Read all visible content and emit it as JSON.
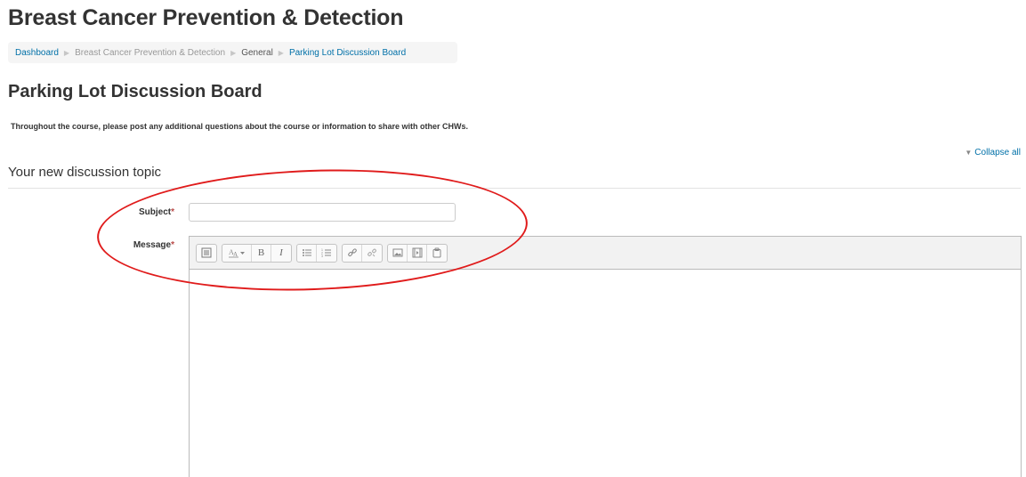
{
  "course": {
    "title": "Breast Cancer Prevention & Detection"
  },
  "breadcrumb": {
    "items": [
      {
        "label": "Dashboard"
      },
      {
        "label": "Breast Cancer Prevention & Detection"
      },
      {
        "label": "General"
      },
      {
        "label": "Parking Lot Discussion Board"
      }
    ],
    "separator": "▶"
  },
  "page": {
    "heading": "Parking Lot Discussion Board",
    "intro": "Throughout the course, please post any additional questions about the course or information to share with other CHWs."
  },
  "collapse_all": {
    "label": "Collapse all",
    "icon": "triangle-down-icon"
  },
  "form": {
    "section_title": "Your new discussion topic",
    "subject": {
      "label": "Subject",
      "required_mark": "*",
      "value": "",
      "placeholder": ""
    },
    "message": {
      "label": "Message",
      "required_mark": "*"
    }
  },
  "editor": {
    "toolbar_groups": [
      [
        "toolbar-toggle-icon"
      ],
      [
        "font-style-icon",
        "bold-icon",
        "italic-icon"
      ],
      [
        "unordered-list-icon",
        "ordered-list-icon"
      ],
      [
        "link-icon",
        "unlink-icon"
      ],
      [
        "image-icon",
        "media-icon",
        "manage-files-icon"
      ]
    ],
    "bold_glyph": "B",
    "italic_glyph": "I"
  },
  "colors": {
    "link": "#0070a8",
    "required": "#b94a48",
    "annotation": "#e01b1b"
  }
}
